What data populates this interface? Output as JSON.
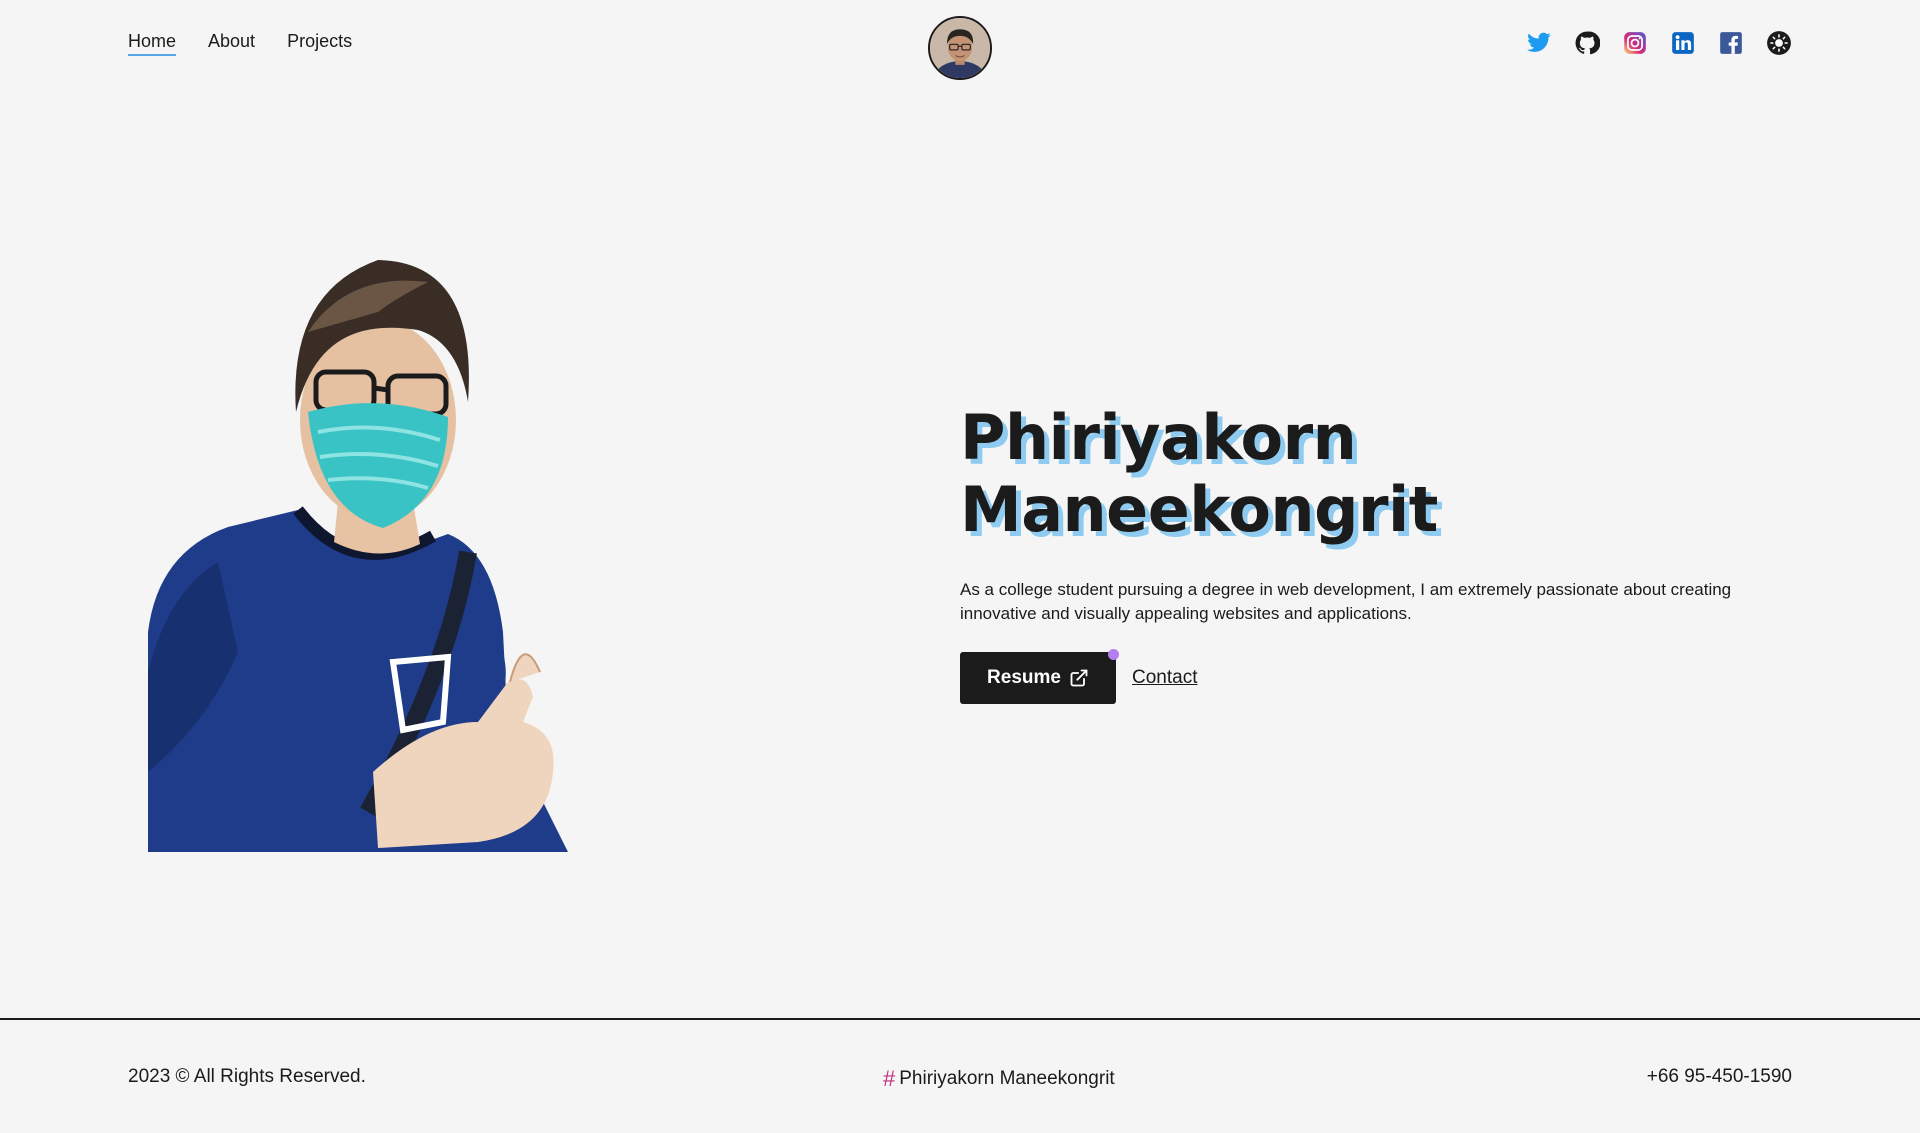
{
  "header": {
    "nav": [
      {
        "label": "Home",
        "active": true
      },
      {
        "label": "About",
        "active": false
      },
      {
        "label": "Projects",
        "active": false
      }
    ],
    "logo_icon": "avatar-portrait",
    "socials": [
      {
        "name": "twitter-icon",
        "color": "#1d9bf0"
      },
      {
        "name": "github-icon",
        "color": "#1b1b1b"
      },
      {
        "name": "instagram-icon",
        "color": "#d62976"
      },
      {
        "name": "linkedin-icon",
        "color": "#0a66c2"
      },
      {
        "name": "facebook-icon",
        "color": "#3b5998"
      },
      {
        "name": "theme-toggle-icon",
        "color": "#1b1b1b"
      }
    ]
  },
  "hero": {
    "title_line1": "Phiriyakorn",
    "title_line2": "Maneekongrit",
    "description": "As a college student pursuing a degree in web development, I am extremely passionate about creating innovative and visually appealing websites and applications.",
    "resume_label": "Resume",
    "contact_label": "Contact",
    "title_shadow_color": "#8fcbf0",
    "accent_dot_color": "#b57ef0"
  },
  "footer": {
    "copyright": "2023 © All Rights Reserved.",
    "hash_symbol": "#",
    "name": "Phiriyakorn Maneekongrit",
    "phone": "+66 95-450-1590"
  }
}
